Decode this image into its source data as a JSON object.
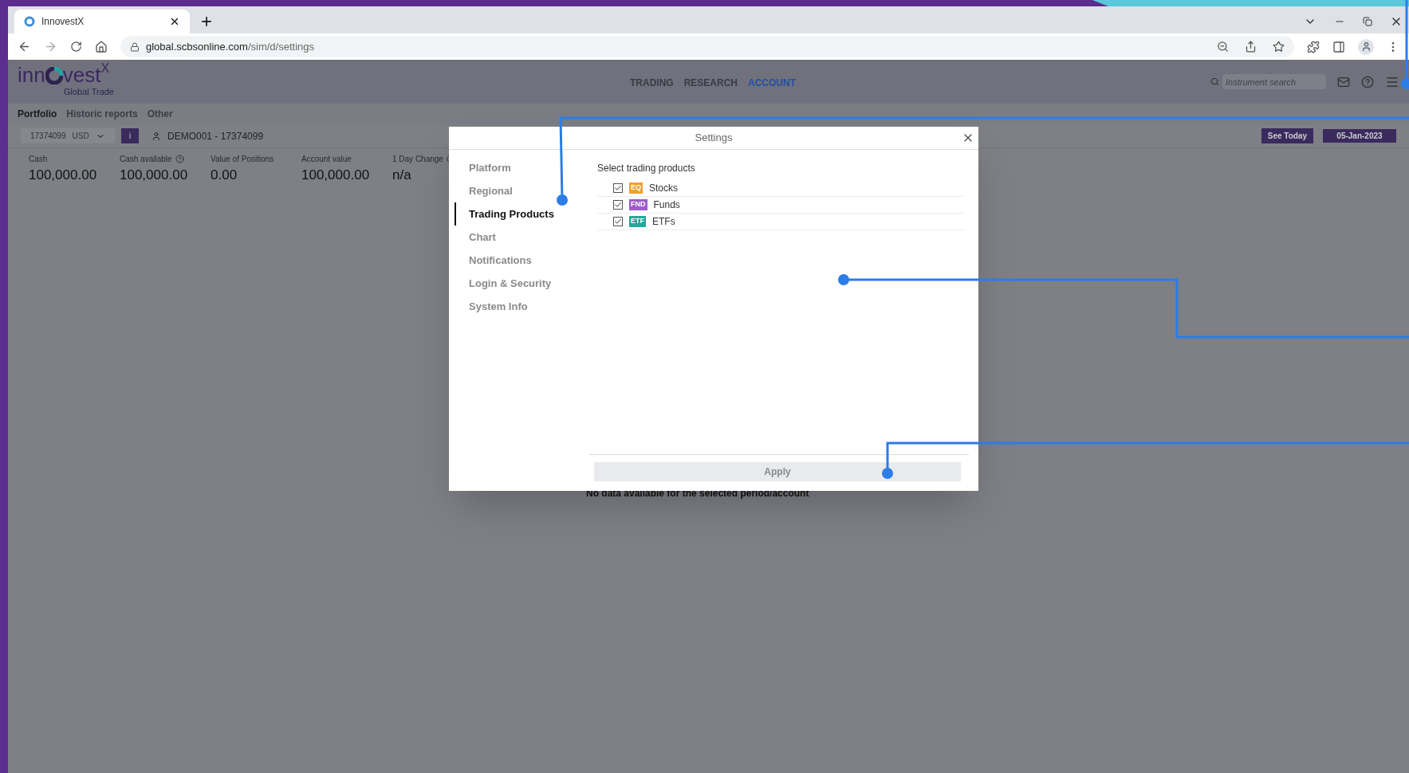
{
  "browser": {
    "tab_title": "InnovestX",
    "url_host": "global.scbsonline.com",
    "url_path": "/sim/d/settings"
  },
  "app": {
    "logo": {
      "left": "inn",
      "right": "vest",
      "sup": "X",
      "subtitle": "Global Trade"
    },
    "nav": [
      {
        "label": "TRADING",
        "selected": false
      },
      {
        "label": "RESEARCH",
        "selected": false
      },
      {
        "label": "ACCOUNT",
        "selected": true
      }
    ],
    "search": {
      "placeholder": "Instrument search"
    },
    "subnav": [
      {
        "label": "Portfolio",
        "selected": true
      },
      {
        "label": "Historic reports",
        "selected": false
      },
      {
        "label": "Other",
        "selected": false
      }
    ],
    "account": {
      "number": "17374099",
      "currency": "USD",
      "info_button": "i",
      "user": "DEMO001 - 17374099"
    },
    "see_today": "See Today",
    "date": "05-Jan-2023",
    "summary": [
      {
        "label": "Cash",
        "value": "100,000.00",
        "info": false
      },
      {
        "label": "Cash available",
        "value": "100,000.00",
        "info": true
      },
      {
        "label": "Value of Positions",
        "value": "0.00",
        "info": false
      },
      {
        "label": "Account value",
        "value": "100,000.00",
        "info": false
      },
      {
        "label": "1 Day Change",
        "value": "n/a",
        "info": true
      }
    ],
    "empty_message": "No data available for the selected period/account"
  },
  "dialog": {
    "title": "Settings",
    "menu": [
      {
        "label": "Platform",
        "selected": false
      },
      {
        "label": "Regional",
        "selected": false
      },
      {
        "label": "Trading Products",
        "selected": true
      },
      {
        "label": "Chart",
        "selected": false
      },
      {
        "label": "Notifications",
        "selected": false
      },
      {
        "label": "Login & Security",
        "selected": false
      },
      {
        "label": "System Info",
        "selected": false
      }
    ],
    "section_title": "Select trading products",
    "products": [
      {
        "label": "Stocks",
        "badge": "EQ",
        "color": "#f0a030",
        "checked": true
      },
      {
        "label": "Funds",
        "badge": "FND",
        "color": "#a05cc8",
        "checked": true
      },
      {
        "label": "ETFs",
        "badge": "ETF",
        "color": "#23a89a",
        "checked": true
      }
    ],
    "apply": "Apply"
  }
}
